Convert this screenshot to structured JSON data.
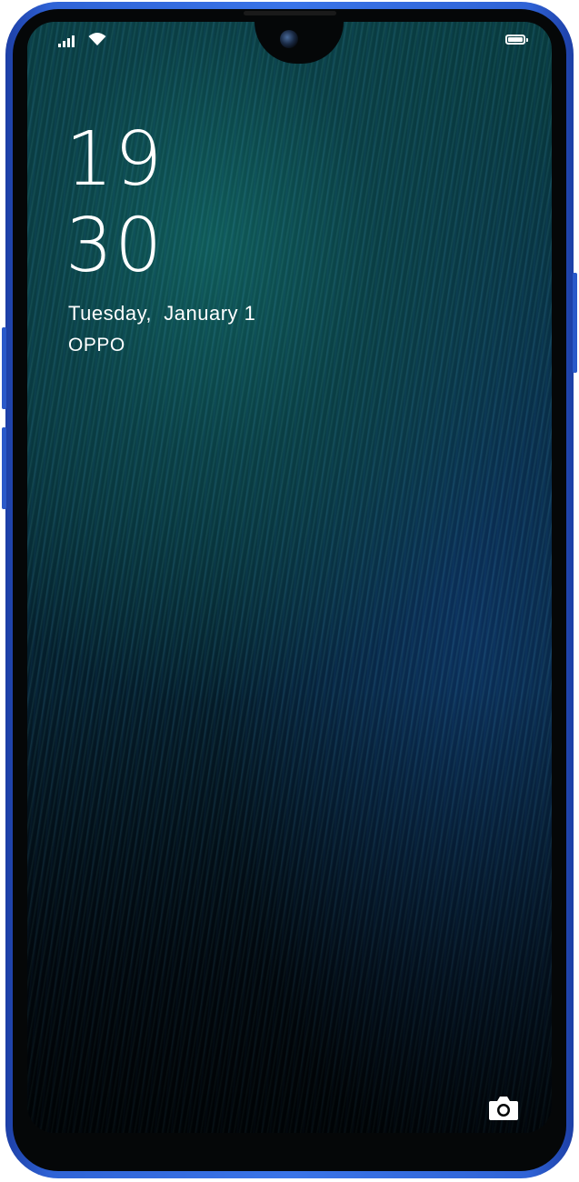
{
  "status_bar": {
    "signal_icon": "cellular-signal-icon",
    "wifi_icon": "wifi-icon",
    "battery_icon": "battery-icon",
    "battery_level": 0.9
  },
  "lockscreen": {
    "clock_hours": "19",
    "clock_minutes": "30",
    "date": "Tuesday,  January 1",
    "operator": "OPPO",
    "camera_shortcut_icon": "camera-icon"
  },
  "theme": {
    "frame_color": "#2f63d6",
    "wallpaper_accent": "#1fa79f"
  }
}
